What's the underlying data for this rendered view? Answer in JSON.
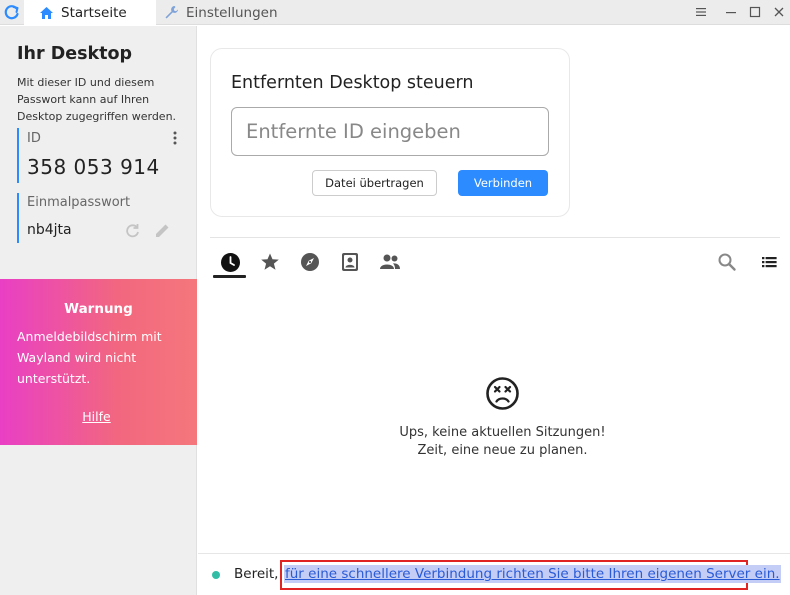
{
  "titlebar": {
    "tabs": [
      {
        "label": "Startseite",
        "icon": "home-icon",
        "active": true
      },
      {
        "label": "Einstellungen",
        "icon": "wrench-icon",
        "active": false
      }
    ],
    "controls": [
      "menu-icon",
      "minimize-icon",
      "maximize-icon",
      "close-icon"
    ]
  },
  "left_panel": {
    "title": "Ihr Desktop",
    "description": "Mit dieser ID und diesem Passwort kann auf Ihren Desktop zugegriffen werden.",
    "id_label": "ID",
    "id_value": "358 053 914",
    "password_label": "Einmalpasswort",
    "password_value": "nb4jta"
  },
  "warning": {
    "title": "Warnung",
    "text": "Anmeldebildschirm mit Wayland wird nicht unterstützt.",
    "link": "Hilfe"
  },
  "connect": {
    "title": "Entfernten Desktop steuern",
    "placeholder": "Entfernte ID eingeben",
    "transfer_label": "Datei übertragen",
    "connect_label": "Verbinden"
  },
  "nav_tabs": [
    "recent-sessions-icon",
    "favorites-icon",
    "discovered-icon",
    "address-book-icon",
    "group-icon"
  ],
  "empty_state": {
    "line1": "Ups, keine aktuellen Sitzungen!",
    "line2": "Zeit, eine neue zu planen."
  },
  "status": {
    "ready": "Bereit,",
    "link": "für eine schnellere Verbindung richten Sie bitte Ihren eigenen Server ein."
  },
  "colors": {
    "accent": "#2c8cff",
    "warning_gradient_start": "#e93fc5",
    "warning_gradient_end": "#f5777c",
    "status_ok": "#32bea6",
    "highlight_border": "#e02424"
  }
}
